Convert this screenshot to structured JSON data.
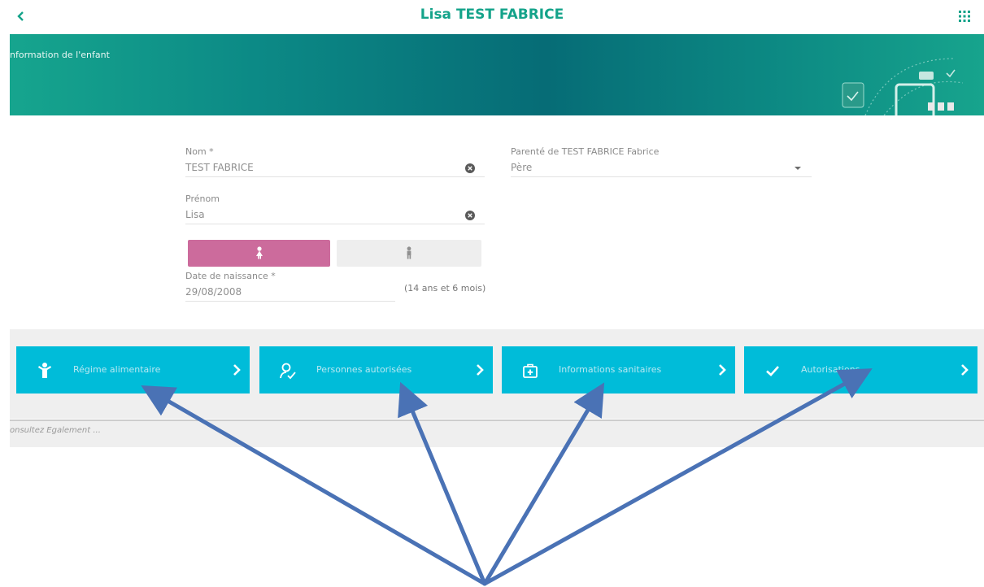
{
  "header": {
    "title": "Lisa TEST FABRICE",
    "back_icon": "chevron-left-icon",
    "menu_icon": "apps-grid-icon",
    "accent_color": "#14a38a"
  },
  "banner": {
    "label": "nformation de l'enfant",
    "art_icon": "calendar-tablet-illustration"
  },
  "form": {
    "last_name": {
      "label": "Nom *",
      "value": "TEST FABRICE"
    },
    "first_name": {
      "label": "Prénom",
      "value": "Lisa"
    },
    "relationship": {
      "label": "Parenté de TEST FABRICE Fabrice",
      "value": "Père"
    },
    "gender": {
      "selected": "girl",
      "girl_color": "#cc6b9c"
    },
    "birth_date": {
      "label": "Date de naissance *",
      "value": "29/08/2008",
      "age": "(14 ans et 6 mois)"
    }
  },
  "tiles": [
    {
      "label": "Régime alimentaire",
      "icon": "child-icon"
    },
    {
      "label": "Personnes autorisées",
      "icon": "person-check-icon"
    },
    {
      "label": "Informations sanitaires",
      "icon": "first-aid-icon"
    },
    {
      "label": "Autorisations",
      "icon": "check-icon"
    }
  ],
  "tile_color": "#00bcd9",
  "see_also": "Consultez Egalement ...",
  "see_also_visible": "onsultez Egalement ...",
  "annotation_color": "#4a72b5"
}
